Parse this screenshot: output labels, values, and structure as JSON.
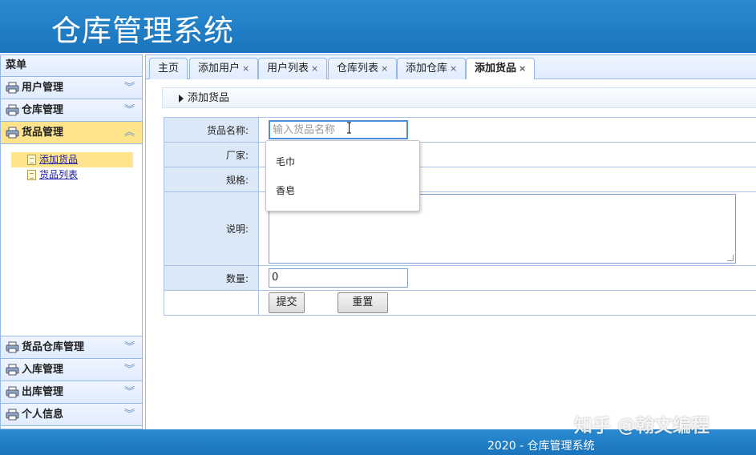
{
  "app": {
    "title": "仓库管理系统"
  },
  "sidebar": {
    "menu_title": "菜单",
    "top_groups": [
      {
        "label": "用户管理",
        "icon": "printer-icon",
        "arrow": "︾"
      },
      {
        "label": "仓库管理",
        "icon": "printer-icon",
        "arrow": "︾"
      },
      {
        "label": "货品管理",
        "icon": "printer-icon",
        "arrow": "︽"
      }
    ],
    "sub_items": [
      {
        "label": "添加货品"
      },
      {
        "label": "货品列表"
      }
    ],
    "bottom_groups": [
      {
        "label": "货品仓库管理",
        "icon": "printer-icon",
        "arrow": "︾"
      },
      {
        "label": "入库管理",
        "icon": "printer-icon",
        "arrow": "︾"
      },
      {
        "label": "出库管理",
        "icon": "printer-icon",
        "arrow": "︾"
      },
      {
        "label": "个人信息",
        "icon": "printer-icon",
        "arrow": "︾"
      }
    ]
  },
  "tabs": [
    {
      "label": "主页"
    },
    {
      "label": "添加用户",
      "close": "×"
    },
    {
      "label": "用户列表",
      "close": "×"
    },
    {
      "label": "仓库列表",
      "close": "×"
    },
    {
      "label": "添加仓库",
      "close": "×"
    },
    {
      "label": "添加货品",
      "close": "×"
    }
  ],
  "breadcrumb": "添加货品",
  "form": {
    "name_label": "货品名称:",
    "name_placeholder": "输入货品名称",
    "maker_label": "厂家:",
    "spec_label": "规格:",
    "desc_label": "说明:",
    "qty_label": "数量:",
    "qty_value": "0",
    "submit": "提交",
    "reset": "重置"
  },
  "autocomplete": [
    "毛巾",
    "香皂"
  ],
  "footer": "2020 - 仓库管理系统",
  "watermark": "知乎 @翰文编程",
  "colors": {
    "header": "#1f7fc6",
    "selected": "#ffe48d",
    "label_cell": "#dbe8f8",
    "border": "#95b8e7"
  }
}
